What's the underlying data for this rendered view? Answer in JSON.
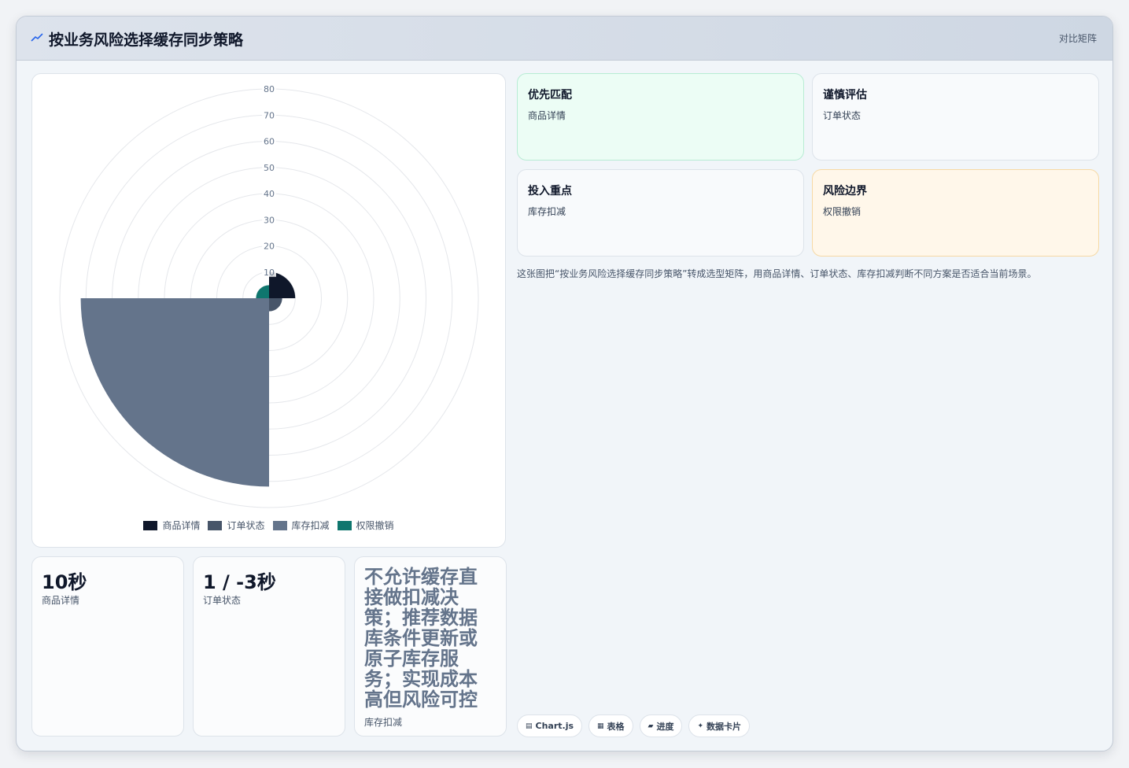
{
  "header": {
    "title": "按业务风险选择缓存同步策略",
    "badge": "对比矩阵",
    "icon": "trend-line-icon"
  },
  "chart_data": {
    "type": "polarArea",
    "categories": [
      "商品详情",
      "订单状态",
      "库存扣减",
      "权限撤销"
    ],
    "values": [
      10,
      5,
      72,
      5
    ],
    "colors": [
      "#0f172a",
      "#475569",
      "#64748b",
      "#0f766e"
    ],
    "r_axis": {
      "min": 0,
      "max": 80,
      "ticks": [
        10,
        20,
        30,
        40,
        50,
        60,
        70,
        80
      ]
    },
    "legend_position": "bottom",
    "grid": true
  },
  "legend": {
    "items": [
      {
        "label": "商品详情",
        "color": "#0f172a"
      },
      {
        "label": "订单状态",
        "color": "#475569"
      },
      {
        "label": "库存扣减",
        "color": "#64748b"
      },
      {
        "label": "权限撤销",
        "color": "#0f766e"
      }
    ]
  },
  "stats": [
    {
      "value": "10秒",
      "label": "商品详情"
    },
    {
      "value": "1 / -3秒",
      "label": "订单状态"
    },
    {
      "value": "不允许缓存直接做扣减决策；推荐数据库条件更新或原子库存服务；实现成本高但风险可控",
      "label": "库存扣减"
    }
  ],
  "matrix": [
    {
      "title": "优先匹配",
      "subtitle": "商品详情",
      "tone": "green"
    },
    {
      "title": "谨慎评估",
      "subtitle": "订单状态",
      "tone": "neutral"
    },
    {
      "title": "投入重点",
      "subtitle": "库存扣减",
      "tone": "neutral"
    },
    {
      "title": "风险边界",
      "subtitle": "权限撤销",
      "tone": "amber"
    }
  ],
  "description": "这张图把“按业务风险选择缓存同步策略”转成选型矩阵，用商品详情、订单状态、库存扣减判断不同方案是否适合当前场景。",
  "chips": [
    {
      "label": "Chart.js",
      "icon": "chart-icon"
    },
    {
      "label": "表格",
      "icon": "table-icon"
    },
    {
      "label": "进度",
      "icon": "progress-icon"
    },
    {
      "label": "数据卡片",
      "icon": "sparkle-icon"
    }
  ]
}
